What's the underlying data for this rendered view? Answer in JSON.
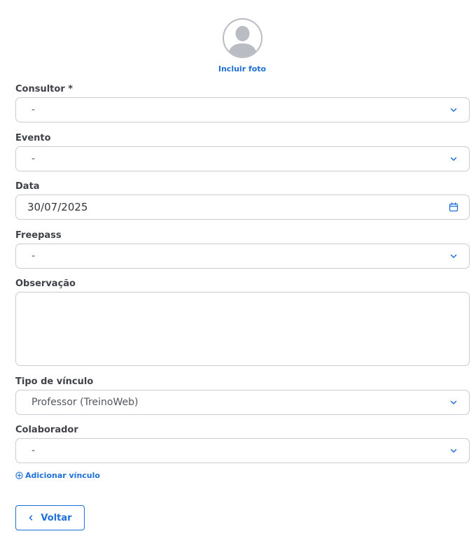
{
  "avatar": {
    "include_photo_label": "Incluir foto"
  },
  "fields": {
    "consultor": {
      "label": "Consultor *",
      "value": "-"
    },
    "evento": {
      "label": "Evento",
      "value": "-"
    },
    "data": {
      "label": "Data",
      "value": "30/07/2025"
    },
    "freepass": {
      "label": "Freepass",
      "value": "-"
    },
    "observacao": {
      "label": "Observação",
      "value": ""
    },
    "tipo_vinculo": {
      "label": "Tipo de vínculo",
      "value": "Professor (TreinoWeb)"
    },
    "colaborador": {
      "label": "Colaborador",
      "value": "-"
    }
  },
  "actions": {
    "add_link_label": "Adicionar vínculo",
    "back_label": "Voltar"
  },
  "icons": {
    "avatar": "user-silhouette-icon",
    "select": "chevron-down-icon",
    "date": "calendar-icon",
    "add": "plus-circle-icon",
    "back": "chevron-left-icon"
  },
  "colors": {
    "accent": "#1e6fd9",
    "border": "#c9ccd1",
    "label": "#3f4349",
    "avatar_gray": "#b9bcc2"
  }
}
